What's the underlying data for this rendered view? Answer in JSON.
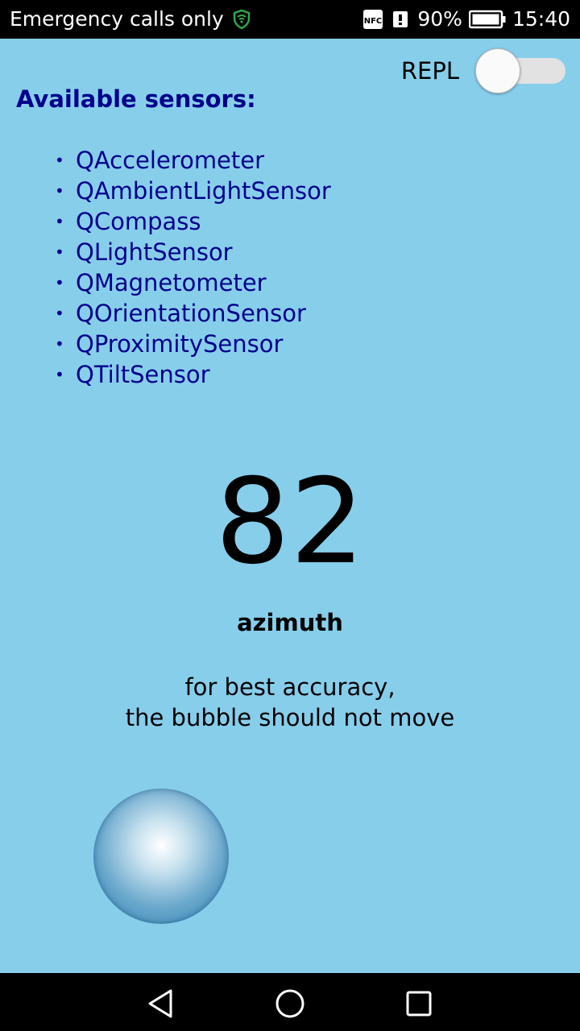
{
  "status_bar": {
    "carrier_text": "Emergency calls only",
    "battery_percent": "90%",
    "time": "15:40",
    "icons": [
      "vpn-shield-icon",
      "nfc-icon",
      "vibrate-icon",
      "battery-icon"
    ],
    "shield_color": "#2ea84a"
  },
  "repl": {
    "label": "REPL",
    "enabled": false
  },
  "sensors": {
    "title": "Available sensors:",
    "items": [
      "QAccelerometer",
      "QAmbientLightSensor",
      "QCompass",
      "QLightSensor",
      "QMagnetometer",
      "QOrientationSensor",
      "QProximitySensor",
      "QTiltSensor"
    ]
  },
  "reading": {
    "value": "82",
    "label": "azimuth",
    "hint_line1": "for best accuracy,",
    "hint_line2": "the bubble should not move"
  },
  "nav": {
    "icons": [
      "back-icon",
      "home-icon",
      "recents-icon"
    ]
  },
  "colors": {
    "background": "#87ceeb",
    "sensor_text": "#00008b"
  }
}
